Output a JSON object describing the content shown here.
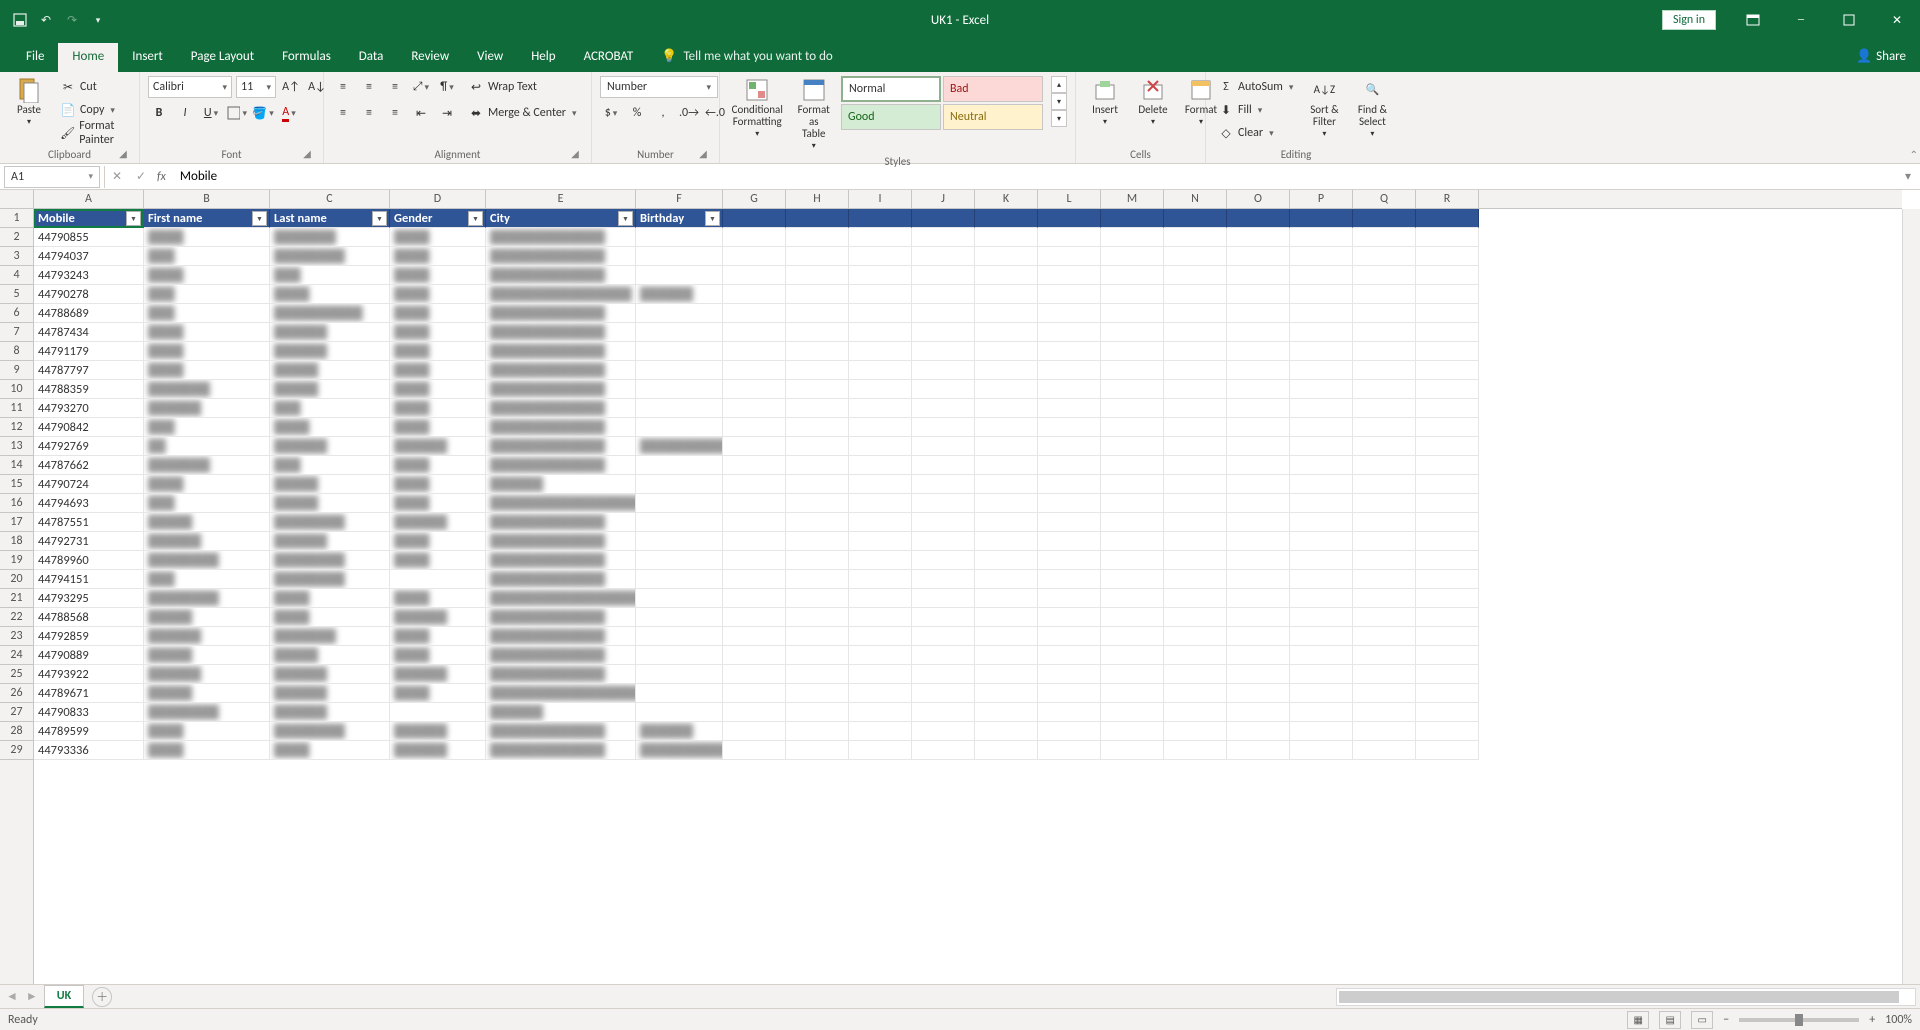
{
  "app": {
    "title": "UK1  -  Excel"
  },
  "titlebar": {
    "signin_label": "Sign in"
  },
  "tabs": {
    "file": "File",
    "home": "Home",
    "insert": "Insert",
    "page_layout": "Page Layout",
    "formulas": "Formulas",
    "data": "Data",
    "review": "Review",
    "view": "View",
    "help": "Help",
    "acrobat": "ACROBAT",
    "tell_me": "Tell me what you want to do",
    "share": "Share"
  },
  "ribbon": {
    "clipboard": {
      "label": "Clipboard",
      "paste": "Paste",
      "cut": "Cut",
      "copy": "Copy",
      "format_painter": "Format Painter"
    },
    "font": {
      "label": "Font",
      "name": "Calibri",
      "size": "11"
    },
    "alignment": {
      "label": "Alignment",
      "wrap_text": "Wrap Text",
      "merge_center": "Merge & Center"
    },
    "number": {
      "label": "Number",
      "format": "Number"
    },
    "styles": {
      "label": "Styles",
      "conditional_formatting": "Conditional Formatting",
      "format_as_table": "Format as Table",
      "normal": "Normal",
      "bad": "Bad",
      "good": "Good",
      "neutral": "Neutral"
    },
    "cells": {
      "label": "Cells",
      "insert": "Insert",
      "delete": "Delete",
      "format": "Format"
    },
    "editing": {
      "label": "Editing",
      "autosum": "AutoSum",
      "fill": "Fill",
      "clear": "Clear",
      "sort_filter": "Sort & Filter",
      "find_select": "Find & Select"
    }
  },
  "formula_bar": {
    "namebox": "A1",
    "formula": "Mobile"
  },
  "columns": {
    "widths": [
      110,
      126,
      120,
      96,
      150,
      87,
      63,
      63,
      63,
      63,
      63,
      63,
      63,
      63,
      63,
      63,
      63,
      63
    ],
    "letters": [
      "A",
      "B",
      "C",
      "D",
      "E",
      "F",
      "G",
      "H",
      "I",
      "J",
      "K",
      "L",
      "M",
      "N",
      "O",
      "P",
      "Q",
      "R"
    ]
  },
  "table": {
    "headers": [
      "Mobile",
      "First name",
      "Last name",
      "Gender",
      "City",
      "Birthday"
    ],
    "rows": [
      {
        "mobile": "44790855",
        "fn": "████",
        "ln": "███████",
        "g": "████",
        "city": "█████████████",
        "bd": ""
      },
      {
        "mobile": "44794037",
        "fn": "███",
        "ln": "████████",
        "g": "████",
        "city": "█████████████",
        "bd": ""
      },
      {
        "mobile": "44793243",
        "fn": "████",
        "ln": "███",
        "g": "████",
        "city": "█████████████",
        "bd": ""
      },
      {
        "mobile": "44790278",
        "fn": "███",
        "ln": "████",
        "g": "████",
        "city": "████████████████",
        "bd": "██████"
      },
      {
        "mobile": "44788689",
        "fn": "███",
        "ln": "██████████",
        "g": "████",
        "city": "█████████████",
        "bd": ""
      },
      {
        "mobile": "44787434",
        "fn": "████",
        "ln": "██████",
        "g": "████",
        "city": "█████████████",
        "bd": ""
      },
      {
        "mobile": "44791179",
        "fn": "████",
        "ln": "██████",
        "g": "████",
        "city": "█████████████",
        "bd": ""
      },
      {
        "mobile": "44787797",
        "fn": "████",
        "ln": "█████",
        "g": "████",
        "city": "█████████████",
        "bd": ""
      },
      {
        "mobile": "44788359",
        "fn": "███████",
        "ln": "█████",
        "g": "████",
        "city": "█████████████",
        "bd": ""
      },
      {
        "mobile": "44793270",
        "fn": "██████",
        "ln": "███",
        "g": "████",
        "city": "█████████████",
        "bd": ""
      },
      {
        "mobile": "44790842",
        "fn": "███",
        "ln": "████",
        "g": "████",
        "city": "█████████████",
        "bd": ""
      },
      {
        "mobile": "44792769",
        "fn": "██",
        "ln": "██████",
        "g": "██████",
        "city": "█████████████",
        "bd": "██████████"
      },
      {
        "mobile": "44787662",
        "fn": "███████",
        "ln": "███",
        "g": "████",
        "city": "█████████████",
        "bd": ""
      },
      {
        "mobile": "44790724",
        "fn": "████",
        "ln": "█████",
        "g": "████",
        "city": "██████",
        "bd": ""
      },
      {
        "mobile": "44794693",
        "fn": "███",
        "ln": "█████",
        "g": "████",
        "city": "███████████████████████",
        "bd": ""
      },
      {
        "mobile": "44787551",
        "fn": "█████",
        "ln": "████████",
        "g": "██████",
        "city": "█████████████",
        "bd": ""
      },
      {
        "mobile": "44792731",
        "fn": "██████",
        "ln": "██████",
        "g": "████",
        "city": "█████████████",
        "bd": ""
      },
      {
        "mobile": "44789960",
        "fn": "████████",
        "ln": "████████",
        "g": "████",
        "city": "█████████████",
        "bd": ""
      },
      {
        "mobile": "44794151",
        "fn": "███",
        "ln": "████████",
        "g": "",
        "city": "█████████████",
        "bd": ""
      },
      {
        "mobile": "44793295",
        "fn": "████████",
        "ln": "████",
        "g": "████",
        "city": "███████████████████",
        "bd": ""
      },
      {
        "mobile": "44788568",
        "fn": "█████",
        "ln": "████",
        "g": "██████",
        "city": "█████████████",
        "bd": ""
      },
      {
        "mobile": "44792859",
        "fn": "██████",
        "ln": "███████",
        "g": "████",
        "city": "█████████████",
        "bd": ""
      },
      {
        "mobile": "44790889",
        "fn": "█████",
        "ln": "█████",
        "g": "████",
        "city": "█████████████",
        "bd": ""
      },
      {
        "mobile": "44793922",
        "fn": "██████",
        "ln": "██████",
        "g": "██████",
        "city": "█████████████",
        "bd": ""
      },
      {
        "mobile": "44789671",
        "fn": "█████",
        "ln": "██████",
        "g": "████",
        "city": "████████████████████████",
        "bd": ""
      },
      {
        "mobile": "44790833",
        "fn": "████████",
        "ln": "██████",
        "g": "",
        "city": "██████",
        "bd": ""
      },
      {
        "mobile": "44789599",
        "fn": "████",
        "ln": "████████",
        "g": "██████",
        "city": "█████████████",
        "bd": "██████"
      },
      {
        "mobile": "44793336",
        "fn": "████",
        "ln": "████",
        "g": "██████",
        "city": "█████████████",
        "bd": "████████████"
      }
    ]
  },
  "sheet": {
    "name": "UK"
  },
  "status": {
    "ready": "Ready",
    "zoom": "100%"
  }
}
